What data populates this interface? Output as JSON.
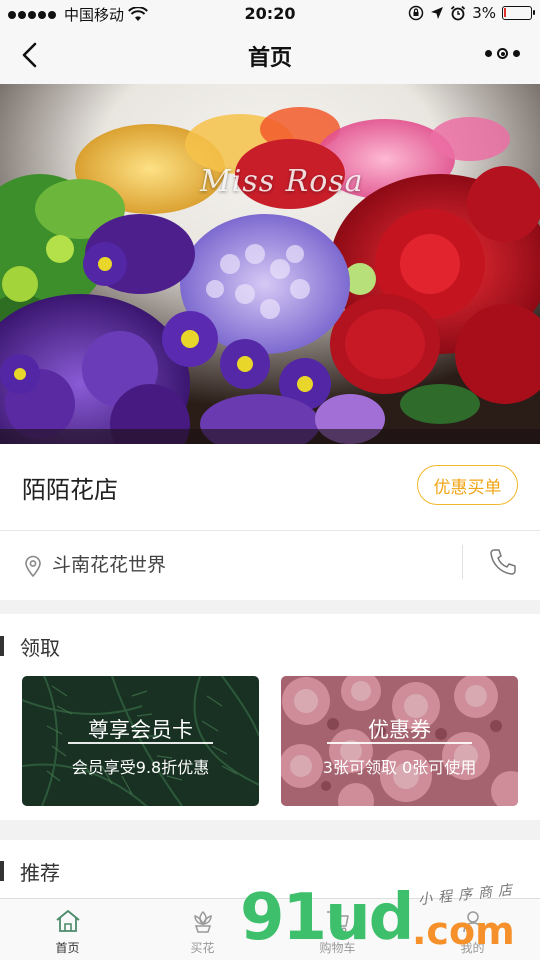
{
  "status_bar": {
    "carrier": "中国移动",
    "time": "20:20",
    "battery": "3%"
  },
  "nav": {
    "title": "首页"
  },
  "banner": {
    "brand": "Miss Rosa"
  },
  "shop": {
    "name": "陌陌花店",
    "promo_button": "优惠买单",
    "address": "斗南花花世界"
  },
  "claim": {
    "title": "领取",
    "member_card": {
      "title": "尊享会员卡",
      "subtitle": "会员享受9.8折优惠"
    },
    "coupon": {
      "title": "优惠券",
      "subtitle": "3张可领取 0张可使用"
    }
  },
  "recommend": {
    "title": "推荐"
  },
  "tabbar": {
    "items": [
      {
        "label": "首页",
        "icon": "home-icon",
        "active": true
      },
      {
        "label": "买花",
        "icon": "flower-icon",
        "active": false
      },
      {
        "label": "购物车",
        "icon": "cart-icon",
        "active": false
      },
      {
        "label": "我的",
        "icon": "user-icon",
        "active": false
      }
    ]
  },
  "watermark": {
    "main": "91ud",
    "domain": ".com",
    "tagline": "小程序商店"
  },
  "colors": {
    "accent": "#f0a517",
    "watermark_green": "#3dbf6c",
    "watermark_orange": "#f5902a"
  }
}
